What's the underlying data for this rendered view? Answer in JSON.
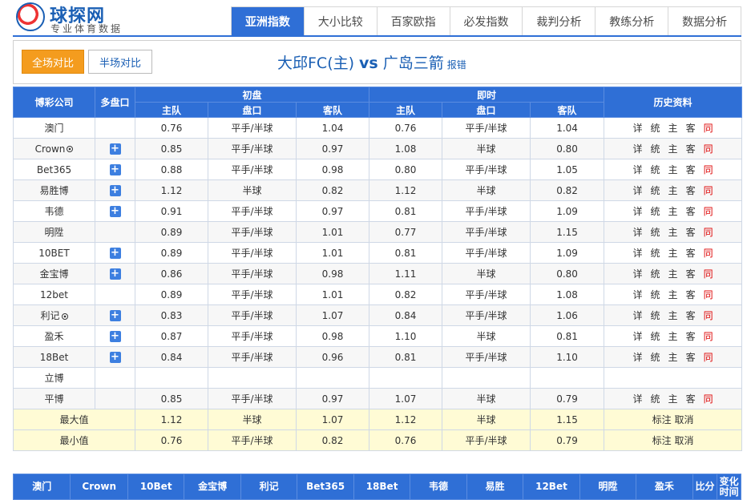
{
  "logo": {
    "name": "球探网",
    "slogan": "专业体育数据"
  },
  "nav": [
    {
      "label": "亚洲指数",
      "active": true
    },
    {
      "label": "大小比较"
    },
    {
      "label": "百家欧指"
    },
    {
      "label": "必发指数"
    },
    {
      "label": "裁判分析"
    },
    {
      "label": "教练分析"
    },
    {
      "label": "数据分析"
    }
  ],
  "toggle": {
    "full": "全场对比",
    "half": "半场对比"
  },
  "match": {
    "home": "大邱FC(主)",
    "vs": "vs",
    "away": "广岛三箭",
    "report": "报错"
  },
  "table": {
    "headers": {
      "company": "博彩公司",
      "multi": "多盘口",
      "initial": "初盘",
      "live": "即时",
      "history": "历史资料",
      "home": "主队",
      "line": "盘口",
      "away": "客队"
    },
    "rows": [
      {
        "company": "澳门",
        "ball": false,
        "plus": false,
        "ih": "0.76",
        "il": "平手/半球",
        "ia": "1.04",
        "lh": "0.76",
        "ll": "平手/半球",
        "la": "1.04",
        "hist": true
      },
      {
        "company": "Crown",
        "ball": true,
        "plus": true,
        "ih": "0.85",
        "il": "平手/半球",
        "ia": "0.97",
        "lh": "1.08",
        "ll": "半球",
        "la": "0.80",
        "hist": true
      },
      {
        "company": "Bet365",
        "ball": false,
        "plus": true,
        "ih": "0.88",
        "il": "平手/半球",
        "ia": "0.98",
        "lh": "0.80",
        "ll": "平手/半球",
        "la": "1.05",
        "hist": true
      },
      {
        "company": "易胜博",
        "ball": false,
        "plus": true,
        "ih": "1.12",
        "il": "半球",
        "ia": "0.82",
        "lh": "1.12",
        "ll": "半球",
        "la": "0.82",
        "hist": true
      },
      {
        "company": "韦德",
        "ball": false,
        "plus": true,
        "ih": "0.91",
        "il": "平手/半球",
        "ia": "0.97",
        "lh": "0.81",
        "ll": "平手/半球",
        "la": "1.09",
        "hist": true
      },
      {
        "company": "明陞",
        "ball": false,
        "plus": false,
        "ih": "0.89",
        "il": "平手/半球",
        "ia": "1.01",
        "lh": "0.77",
        "ll": "平手/半球",
        "la": "1.15",
        "hist": true
      },
      {
        "company": "10BET",
        "ball": false,
        "plus": true,
        "ih": "0.89",
        "il": "平手/半球",
        "ia": "1.01",
        "lh": "0.81",
        "ll": "平手/半球",
        "la": "1.09",
        "hist": true
      },
      {
        "company": "金宝博",
        "ball": false,
        "plus": true,
        "ih": "0.86",
        "il": "平手/半球",
        "ia": "0.98",
        "lh": "1.11",
        "ll": "半球",
        "la": "0.80",
        "hist": true
      },
      {
        "company": "12bet",
        "ball": false,
        "plus": false,
        "ih": "0.89",
        "il": "平手/半球",
        "ia": "1.01",
        "lh": "0.82",
        "ll": "平手/半球",
        "la": "1.08",
        "hist": true
      },
      {
        "company": "利记",
        "ball": true,
        "plus": true,
        "ih": "0.83",
        "il": "平手/半球",
        "ia": "1.07",
        "lh": "0.84",
        "ll": "平手/半球",
        "la": "1.06",
        "hist": true
      },
      {
        "company": "盈禾",
        "ball": false,
        "plus": true,
        "ih": "0.87",
        "il": "平手/半球",
        "ia": "0.98",
        "lh": "1.10",
        "ll": "半球",
        "la": "0.81",
        "hist": true
      },
      {
        "company": "18Bet",
        "ball": false,
        "plus": true,
        "ih": "0.84",
        "il": "平手/半球",
        "ia": "0.96",
        "lh": "0.81",
        "ll": "平手/半球",
        "la": "1.10",
        "hist": true
      },
      {
        "company": "立博",
        "ball": false,
        "plus": false,
        "ih": "",
        "il": "",
        "ia": "",
        "lh": "",
        "ll": "",
        "la": "",
        "hist": false
      },
      {
        "company": "平博",
        "ball": false,
        "plus": false,
        "ih": "0.85",
        "il": "平手/半球",
        "ia": "0.97",
        "lh": "1.07",
        "ll": "半球",
        "la": "0.79",
        "hist": true
      }
    ],
    "hist_links": [
      "详",
      "统",
      "主",
      "客",
      "同"
    ],
    "max": {
      "label": "最大值",
      "ih": "1.12",
      "il": "半球",
      "ia": "1.07",
      "lh": "1.12",
      "ll": "半球",
      "la": "1.15",
      "note": "标注",
      "cancel": "取消"
    },
    "min": {
      "label": "最小值",
      "ih": "0.76",
      "il": "平手/半球",
      "ia": "0.82",
      "lh": "0.76",
      "ll": "平手/半球",
      "la": "0.79",
      "note": "标注",
      "cancel": "取消"
    }
  },
  "bottom_headers": [
    "澳门",
    "Crown",
    "10Bet",
    "金宝博",
    "利记",
    "Bet365",
    "18Bet",
    "韦德",
    "易胜",
    "12Bet",
    "明陞",
    "盈禾",
    "比分",
    "变化时间"
  ],
  "colors": {
    "brand": "#2f6fd6",
    "accent": "#f49c1e",
    "history_red": "#dd0000",
    "summary_bg": "#fffbd5"
  }
}
